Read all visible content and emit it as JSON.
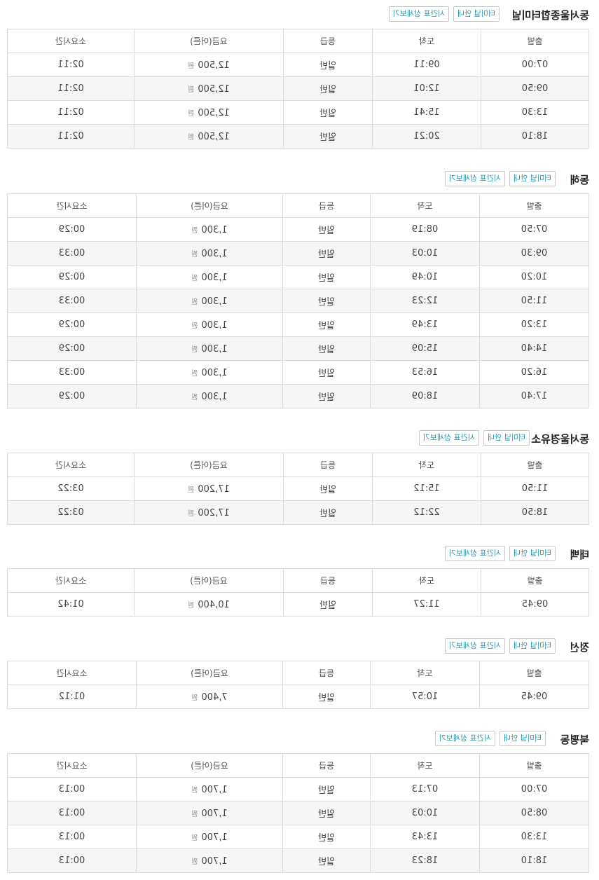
{
  "headers": [
    "출발",
    "도착",
    "등급",
    "요금(어른)",
    "소요시간"
  ],
  "sections": [
    {
      "title": "동서울종합터미널",
      "btn_info": "터미널 안내",
      "btn_sched": "시간표 상세보기",
      "rows": [
        [
          "07:00",
          "09:11",
          "일반",
          "12,500",
          "원",
          "02:11"
        ],
        [
          "09:50",
          "12:01",
          "일반",
          "12,500",
          "원",
          "02:11"
        ],
        [
          "13:30",
          "15:41",
          "일반",
          "12,500",
          "원",
          "02:11"
        ],
        [
          "18:10",
          "20:21",
          "일반",
          "12,500",
          "원",
          "02:11"
        ]
      ]
    },
    {
      "title": "동해",
      "btn_info": "터미널 안내",
      "btn_sched": "시간표 상세보기",
      "rows": [
        [
          "07:50",
          "08:19",
          "일반",
          "1,300",
          "원",
          "00:29"
        ],
        [
          "09:30",
          "10:03",
          "일반",
          "1,300",
          "원",
          "00:33"
        ],
        [
          "10:20",
          "10:49",
          "일반",
          "1,300",
          "원",
          "00:29"
        ],
        [
          "11:50",
          "12:23",
          "일반",
          "1,300",
          "원",
          "00:33"
        ],
        [
          "13:20",
          "13:49",
          "일반",
          "1,300",
          "원",
          "00:29"
        ],
        [
          "14:40",
          "15:09",
          "일반",
          "1,300",
          "원",
          "00:29"
        ],
        [
          "16:20",
          "16:53",
          "일반",
          "1,300",
          "원",
          "00:33"
        ],
        [
          "17:40",
          "18:09",
          "일반",
          "1,300",
          "원",
          "00:29"
        ]
      ]
    },
    {
      "title": "동서울경유소",
      "btn_info": "터미널 안내",
      "btn_sched": "시간표 상세보기",
      "rows": [
        [
          "11:50",
          "15:12",
          "일반",
          "17,200",
          "원",
          "03:22"
        ],
        [
          "18:50",
          "22:12",
          "일반",
          "17,200",
          "원",
          "03:22"
        ]
      ]
    },
    {
      "title": "태백",
      "btn_info": "터미널 안내",
      "btn_sched": "시간표 상세보기",
      "rows": [
        [
          "09:45",
          "11:27",
          "일반",
          "10,400",
          "원",
          "01:42"
        ]
      ]
    },
    {
      "title": "정선",
      "btn_info": "터미널 안내",
      "btn_sched": "시간표 상세보기",
      "rows": [
        [
          "09:45",
          "10:57",
          "일반",
          "7,400",
          "원",
          "01:12"
        ]
      ]
    },
    {
      "title": "북평동",
      "btn_info": "터미널 안내",
      "btn_sched": "시간표 상세보기",
      "rows": [
        [
          "07:00",
          "07:13",
          "일반",
          "1,700",
          "원",
          "00:13"
        ],
        [
          "08:50",
          "10:03",
          "일반",
          "1,700",
          "원",
          "00:13"
        ],
        [
          "13:30",
          "13:43",
          "일반",
          "1,700",
          "원",
          "00:13"
        ],
        [
          "18:10",
          "18:23",
          "일반",
          "1,700",
          "원",
          "00:13"
        ]
      ]
    }
  ]
}
